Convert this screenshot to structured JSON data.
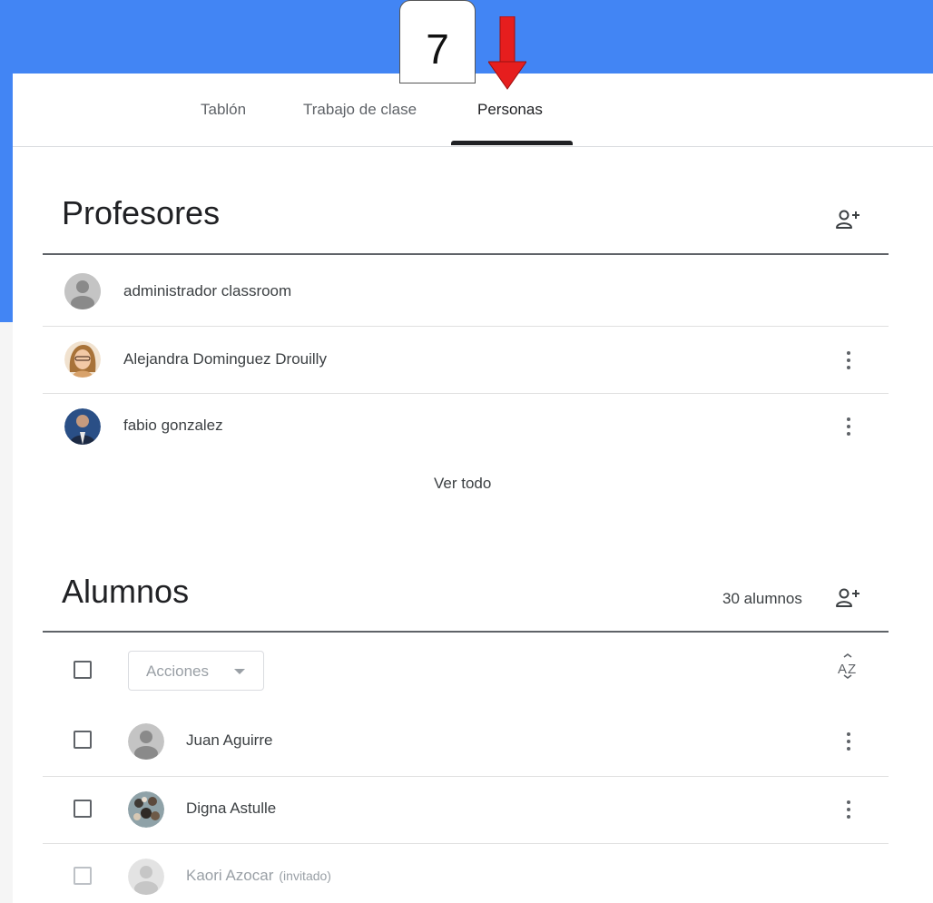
{
  "overlay": {
    "step_number": "7"
  },
  "tabs": [
    {
      "label": "Tablón"
    },
    {
      "label": "Trabajo de clase"
    },
    {
      "label": "Personas"
    }
  ],
  "teachers": {
    "title": "Profesores",
    "add_icon": "person-add-icon",
    "items": [
      {
        "name": "administrador classroom",
        "avatar": "default-avatar-icon"
      },
      {
        "name": "Alejandra Dominguez Drouilly",
        "avatar": "photo-avatar"
      },
      {
        "name": "fabio gonzalez",
        "avatar": "photo-avatar"
      }
    ],
    "see_all": "Ver todo"
  },
  "students": {
    "title": "Alumnos",
    "count": "30 alumnos",
    "add_icon": "person-add-icon",
    "actions_label": "Acciones",
    "sort_icon": "sort-az-icon",
    "items": [
      {
        "name": "Juan Aguirre",
        "avatar": "default-avatar-icon"
      },
      {
        "name": "Digna Astulle",
        "avatar": "photo-avatar"
      },
      {
        "name": "Kaori Azocar",
        "status": "(invitado)",
        "avatar": "default-avatar-icon"
      }
    ]
  },
  "colors": {
    "header_blue": "#4285f4",
    "arrow_red": "#e61e1e",
    "text_primary": "#202124",
    "text_secondary": "#5f6368"
  }
}
